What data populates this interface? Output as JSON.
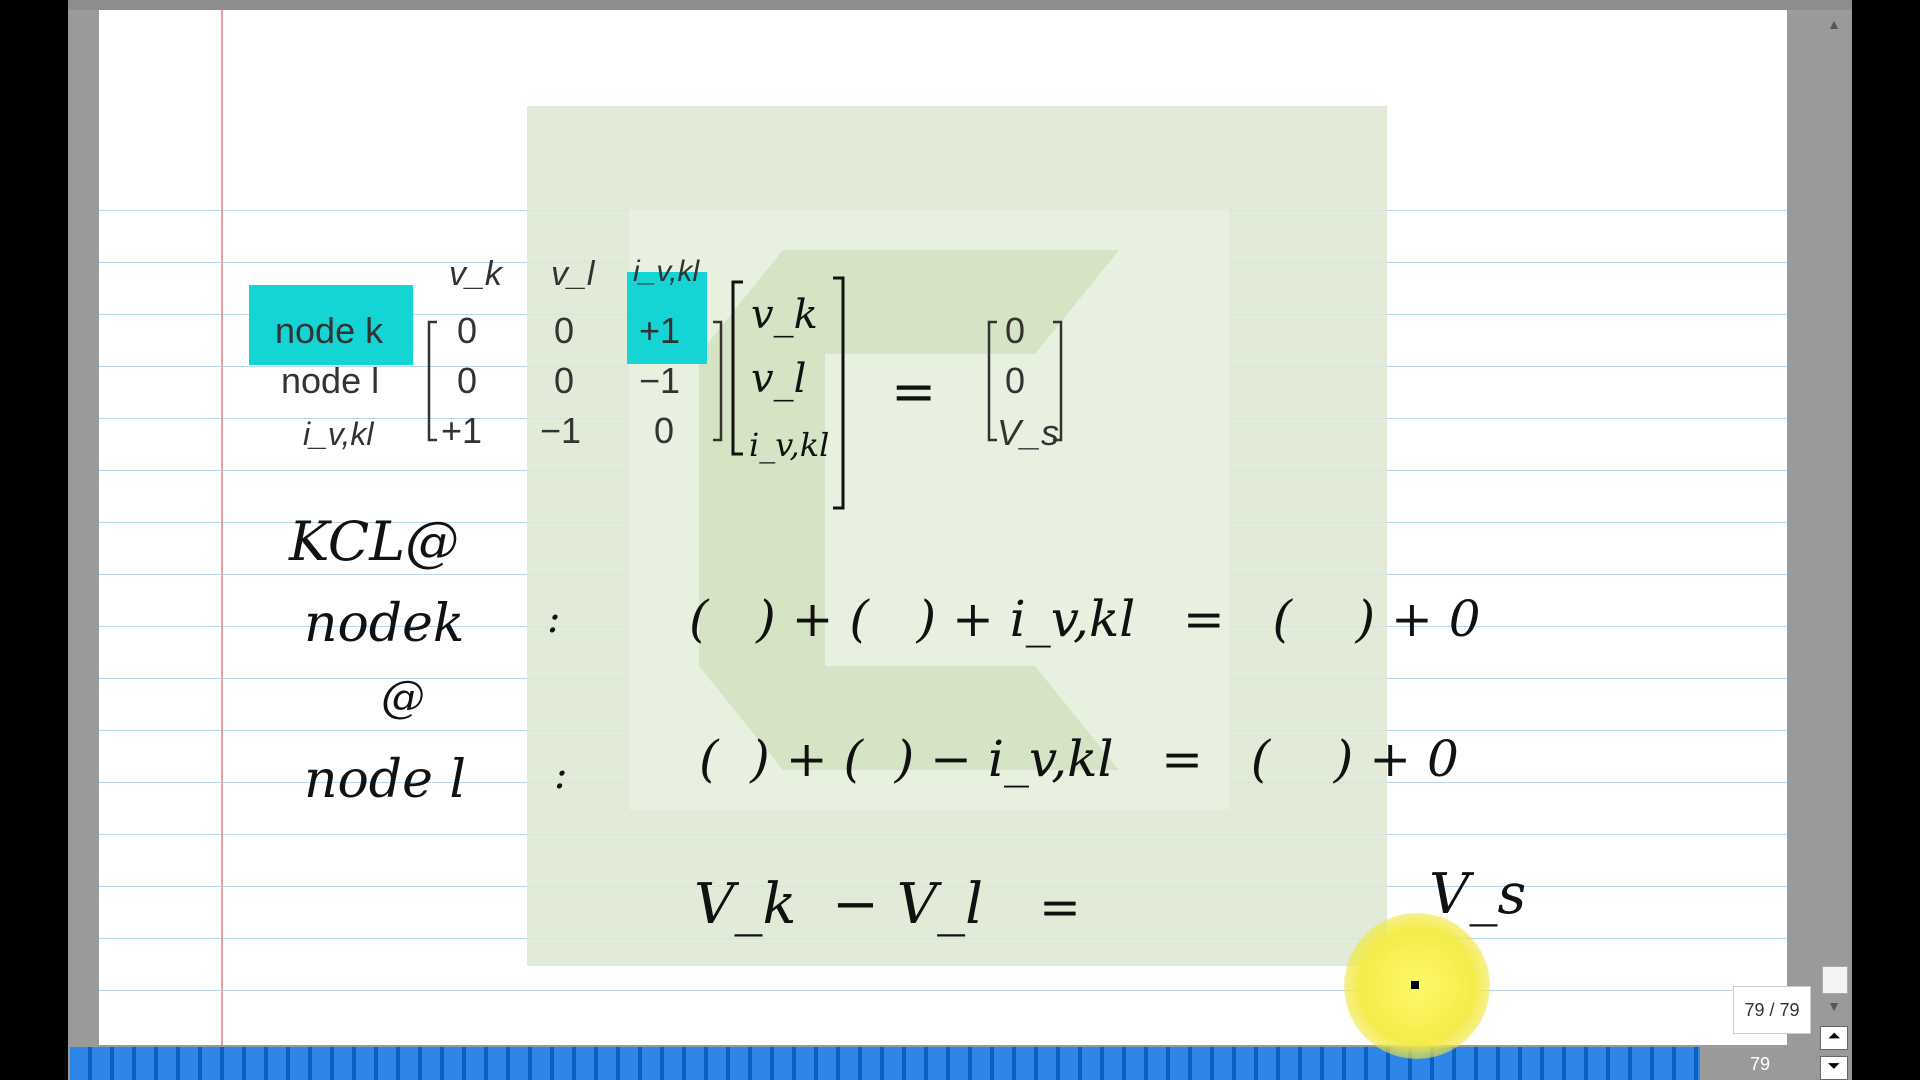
{
  "matrix": {
    "col_headers": [
      "v_k",
      "v_l",
      "i_v,kl"
    ],
    "row_labels": [
      "node k",
      "node l",
      "i_v,kl"
    ],
    "rows": [
      [
        "0",
        "0",
        "+1"
      ],
      [
        "0",
        "0",
        "−1"
      ],
      [
        "+1",
        "−1",
        "0"
      ]
    ],
    "unknowns": [
      "v_k",
      "v_l",
      "i_v,kl"
    ],
    "equals": "=",
    "rhs": [
      "0",
      "0",
      "V_s"
    ]
  },
  "handwriting": {
    "kcl_label": "KCL@",
    "nodek_label": "nodek",
    "at_symbol": "@",
    "nodel_label": "node l",
    "colon": ":",
    "eq1": "(   ) + (   ) + i_v,kl   =   (    ) + 0",
    "eq2": "(  ) + (  ) − i_v,kl   =   (    ) + 0",
    "eq3_lhs": "V_k  − V_l",
    "eq3_eq": "=",
    "eq3_rhs": "V_s"
  },
  "viewer": {
    "page_indicator": "79 / 79",
    "current_page": "79"
  },
  "colors": {
    "highlight": "#14d4d4",
    "ruled_line": "#b7d7ee",
    "margin_line": "#e8a0a8",
    "progress_bar": "#2d86e8"
  }
}
